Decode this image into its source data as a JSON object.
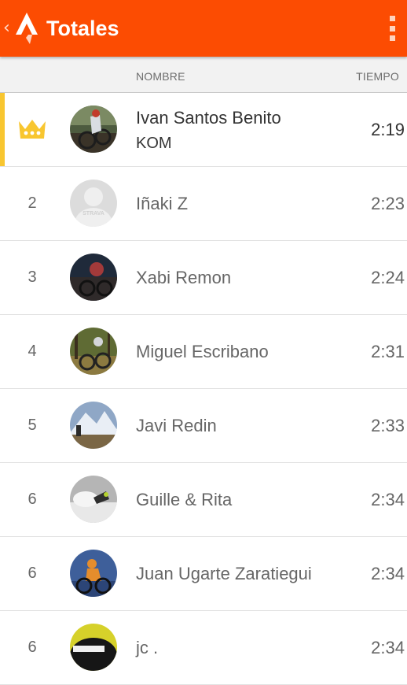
{
  "appbar": {
    "title": "Totales"
  },
  "header": {
    "name_col": "NOMBRE",
    "time_col": "TIEMPO"
  },
  "leader": {
    "rank_icon": "crown-icon",
    "name": "Ivan Santos Benito",
    "badge": "KOM",
    "time": "2:19"
  },
  "entries": [
    {
      "rank": "2",
      "name": "Iñaki Z",
      "time": "2:23",
      "avatar_text": "STRAVA"
    },
    {
      "rank": "3",
      "name": "Xabi Remon",
      "time": "2:24"
    },
    {
      "rank": "4",
      "name": "Miguel Escribano",
      "time": "2:31"
    },
    {
      "rank": "5",
      "name": "Javi Redin",
      "time": "2:33"
    },
    {
      "rank": "6",
      "name": "Guille & Rita",
      "time": "2:34"
    },
    {
      "rank": "6",
      "name": "Juan Ugarte Zaratiegui",
      "time": "2:34"
    },
    {
      "rank": "6",
      "name": "jc .",
      "time": "2:34"
    }
  ],
  "colors": {
    "brand": "#fc4c02",
    "kom": "#f8c630",
    "text_primary": "#333333",
    "text_secondary": "#666666"
  }
}
